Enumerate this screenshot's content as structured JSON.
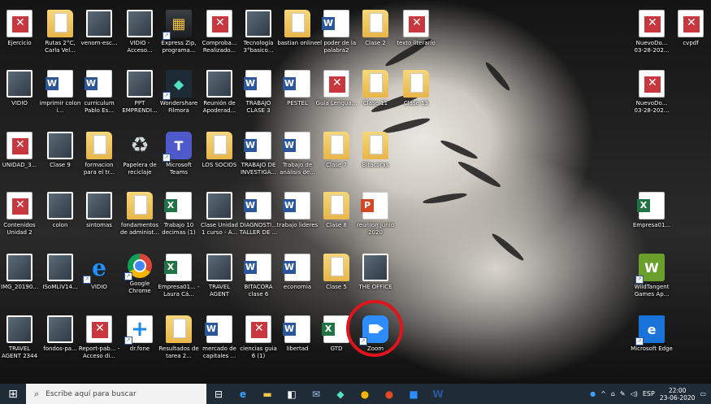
{
  "desktop": {
    "icons": [
      {
        "name": "Ejercicio",
        "type": "pdf"
      },
      {
        "name": "Rutas 2°C, Carla Vel...",
        "type": "folder"
      },
      {
        "name": "venom-esc...",
        "type": "photo"
      },
      {
        "name": "VIDIO - Acceso...",
        "type": "photo"
      },
      {
        "name": "Express Zip, programa...",
        "type": "zip"
      },
      {
        "name": "Comproba... Realizado...",
        "type": "pdf"
      },
      {
        "name": "Tecnología 3°basico...",
        "type": "photo"
      },
      {
        "name": "bastian online",
        "type": "folder"
      },
      {
        "name": "el poder de la palabra2",
        "type": "word"
      },
      {
        "name": "Clase 2",
        "type": "folder"
      },
      {
        "name": "texto literario",
        "type": "pdf"
      },
      {
        "name": "NuevoDo... 03-28-202...",
        "type": "pdf"
      },
      {
        "name": "cvpdf",
        "type": "pdf"
      },
      {
        "name": "VIDIO",
        "type": "photo"
      },
      {
        "name": "imprimir colon i...",
        "type": "word"
      },
      {
        "name": "curriculum Pablo Es...",
        "type": "word"
      },
      {
        "name": "PPT EMPRENDI...",
        "type": "photo"
      },
      {
        "name": "Wondershare Filmora",
        "type": "filmora"
      },
      {
        "name": "Reunión de Apoderad...",
        "type": "photo"
      },
      {
        "name": "TRABAJO CLASE 3",
        "type": "word"
      },
      {
        "name": "PESTEL",
        "type": "word"
      },
      {
        "name": "Guia Lengua...",
        "type": "pdf"
      },
      {
        "name": "Clase 11",
        "type": "folder"
      },
      {
        "name": "Clase 13",
        "type": "folder"
      },
      {
        "name": "NuevoDo... 03-28-202...",
        "type": "pdf"
      },
      {
        "name": "UNIDAD_3...",
        "type": "pdf"
      },
      {
        "name": "Clase 9",
        "type": "photo"
      },
      {
        "name": "formacion para el tr...",
        "type": "folder"
      },
      {
        "name": "Papelera de reciclaje",
        "type": "recycle"
      },
      {
        "name": "Microsoft Teams",
        "type": "teams"
      },
      {
        "name": "LOS SOCIOS",
        "type": "folder"
      },
      {
        "name": "TRABAJO DE INVESTIGA...",
        "type": "word"
      },
      {
        "name": "Trabajo de análisis de...",
        "type": "word"
      },
      {
        "name": "Clase 7",
        "type": "folder"
      },
      {
        "name": "Bitacoras",
        "type": "folder"
      },
      {
        "name": "Contenidos Unidad 2",
        "type": "pdf"
      },
      {
        "name": "colon",
        "type": "photo"
      },
      {
        "name": "sintomas",
        "type": "photo"
      },
      {
        "name": "fondamentos de administ...",
        "type": "folder"
      },
      {
        "name": "Trabajo 10 decimas (1)",
        "type": "excel"
      },
      {
        "name": "Clase Unidad 1 curso - A...",
        "type": "photo"
      },
      {
        "name": "DIAGNOSTI... TALLER DE ...",
        "type": "word"
      },
      {
        "name": "trabajo lideres",
        "type": "word"
      },
      {
        "name": "Clase 8",
        "type": "folder"
      },
      {
        "name": "reunion junio 2020",
        "type": "ppt"
      },
      {
        "name": "Empresa01...",
        "type": "excel"
      },
      {
        "name": "IMG_20190...",
        "type": "photo"
      },
      {
        "name": "ISoMLIV14...",
        "type": "photo"
      },
      {
        "name": "VIDIO",
        "type": "ie"
      },
      {
        "name": "Google Chrome",
        "type": "chrome"
      },
      {
        "name": "Empresa01... - Laura Cá...",
        "type": "excel"
      },
      {
        "name": "TRAVEL AGENT",
        "type": "photo"
      },
      {
        "name": "BITACORA clase 6",
        "type": "word"
      },
      {
        "name": "economia",
        "type": "word"
      },
      {
        "name": "Clase 5",
        "type": "folder"
      },
      {
        "name": "THE OFFICE",
        "type": "photo"
      },
      {
        "name": "WildTangent Games Ap...",
        "type": "wt"
      },
      {
        "name": "TRAVEL AGENT 2344",
        "type": "photo"
      },
      {
        "name": "fondos-pa...",
        "type": "photo"
      },
      {
        "name": "Report-pab... - Acceso di...",
        "type": "pdf"
      },
      {
        "name": "dr.fone",
        "type": "drfone"
      },
      {
        "name": "Resultados de tarea 2...",
        "type": "folder"
      },
      {
        "name": "mercado de capitales ...",
        "type": "word"
      },
      {
        "name": "ciencias guia 6 (1)",
        "type": "pdf"
      },
      {
        "name": "libertad",
        "type": "word"
      },
      {
        "name": "GTD",
        "type": "excel"
      },
      {
        "name": "Zoom",
        "type": "zoom"
      },
      {
        "name": "Microsoft Edge",
        "type": "edge"
      }
    ]
  },
  "taskbar": {
    "search_placeholder": "Escribe aquí para buscar",
    "language": "ESP",
    "time": "22:00",
    "date": "23-06-2020"
  },
  "colors": {
    "highlight": "#e0141c",
    "taskbar": "#1f2b36",
    "zoom": "#2d8cff"
  }
}
